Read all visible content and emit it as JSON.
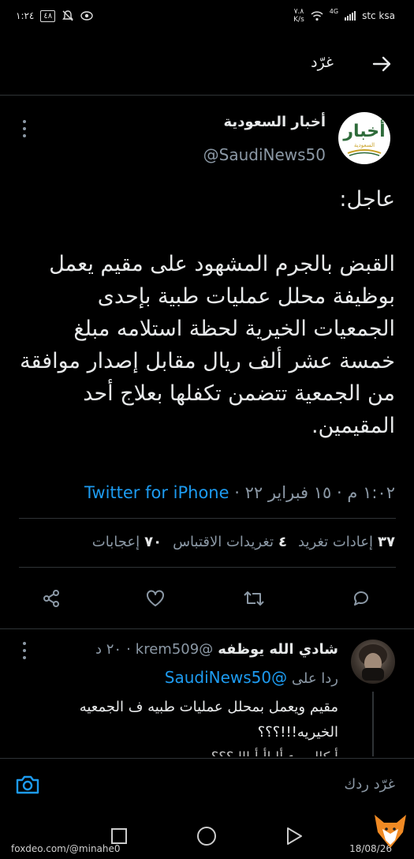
{
  "status_bar": {
    "time": "١:٢٤",
    "battery": "٤٨",
    "net_speed": "٧.٨",
    "net_unit": "K/s",
    "signal_tag": "4G",
    "carrier": "stc ksa"
  },
  "header": {
    "title": "غرّد"
  },
  "tweet": {
    "display_name": "أخبار السعودية",
    "handle": "@SaudiNews50",
    "avatar_text": "أخبار",
    "avatar_sub": "السعودية",
    "body": "عاجل:\n\nالقبض بالجرم المشهود على مقيم يعمل بوظيفة محلل عمليات طبية بإحدى الجمعيات الخيرية لحظة استلامه مبلغ خمسة عشر ألف ريال مقابل إصدار موافقة من الجمعية تتضمن تكفلها بعلاج أحد المقيمين.",
    "time": "١:٠٢ م",
    "date": "١٥ فبراير ٢٢",
    "separator": "·",
    "source": "Twitter for iPhone",
    "stats": {
      "retweets_count": "٣٧",
      "retweets_label": "إعادات تغريد",
      "quotes_count": "٤",
      "quotes_label": "تغريدات الاقتباس",
      "likes_count": "٧٠",
      "likes_label": "إعجابات"
    }
  },
  "reply": {
    "name": "شادي الله يوظفه",
    "handle": "@krem509",
    "time": "٢٠ د",
    "dot": "·",
    "replying_to_label": "ردا على",
    "replying_to": "@SaudiNews50",
    "text": "مقيم ويعمل بمحلل عمليات طبيه ف الجمعيه الخيريه!!!؟؟؟",
    "text_cut": "أ كالسوء أا اأ أ ااا ؟؟؟"
  },
  "compose": {
    "placeholder": "غرّد ردك"
  },
  "watermark": {
    "left": "foxdeo.com/@minahe0",
    "right": "18/08/26"
  },
  "colors": {
    "background": "#000000",
    "accent": "#1d9bf0",
    "secondary_text": "#8b98a5",
    "divider": "#2f3336"
  }
}
